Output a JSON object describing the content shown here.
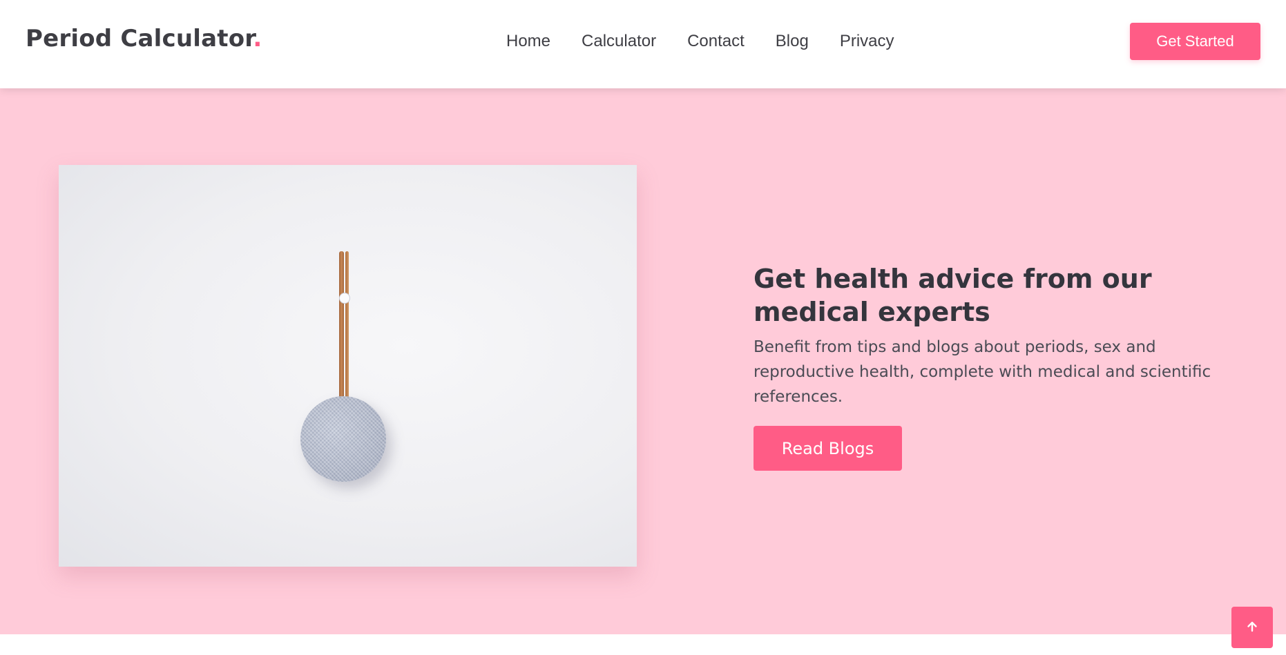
{
  "brand": {
    "name": "Period Calculator",
    "dot": "."
  },
  "nav": {
    "items": [
      {
        "label": "Home"
      },
      {
        "label": "Calculator"
      },
      {
        "label": "Contact"
      },
      {
        "label": "Blog"
      },
      {
        "label": "Privacy"
      }
    ]
  },
  "header": {
    "cta_label": "Get Started"
  },
  "hero": {
    "title": "Get health advice from our medical experts",
    "text": "Benefit from tips and blogs about periods, sex and reproductive health, complete with medical and scientific references.",
    "cta_label": "Read Blogs"
  },
  "scroll_top": {
    "icon": "arrow-up-icon"
  },
  "colors": {
    "accent": "#ff5c86",
    "hero_bg": "#ffcbd9",
    "text_dark": "#34353d"
  }
}
